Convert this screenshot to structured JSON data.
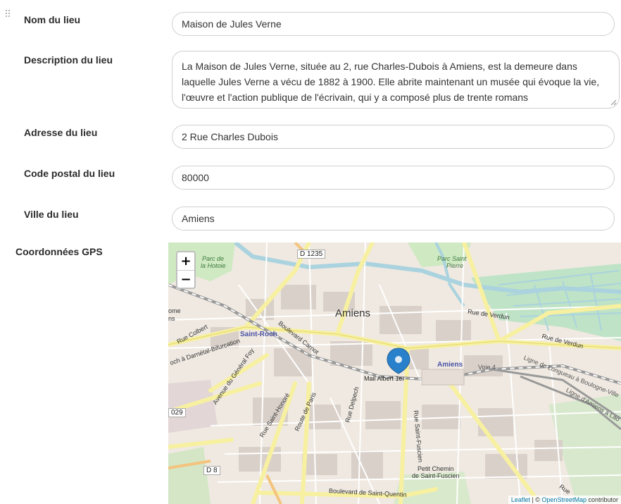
{
  "form": {
    "name_label": "Nom du lieu",
    "name_value": "Maison de Jules Verne",
    "description_label": "Description du lieu",
    "description_value": "La Maison de Jules Verne, située au 2, rue Charles-Dubois à Amiens, est la demeure dans laquelle Jules Verne a vécu de 1882 à 1900. Elle abrite maintenant un musée qui évoque la vie, l'œuvre et l'action publique de l'écrivain, qui y a composé plus de trente romans",
    "address_label": "Adresse du lieu",
    "address_value": "2 Rue Charles Dubois",
    "postcode_label": "Code postal du lieu",
    "postcode_value": "80000",
    "city_label": "Ville du lieu",
    "city_value": "Amiens",
    "gps_label": "Coordonnées GPS"
  },
  "map": {
    "zoom_in": "+",
    "zoom_out": "−",
    "attribution_leaflet": "Leaflet",
    "attribution_sep": " | © ",
    "attribution_osm": "OpenStreetMap",
    "attribution_rest": " contributor",
    "labels": {
      "city": "Amiens",
      "d1235": "D 1235",
      "parc_hotoie_1": "Parc de",
      "parc_hotoie_2": "la Hotoie",
      "parc_saint_pierre_1": "Parc Saint",
      "parc_saint_pierre_2": "Pierre",
      "rue_verdun_1": "Rue de Verdun",
      "rue_verdun_2": "Rue de Verdun",
      "saint_roch": "Saint-Roch",
      "rue_colbert": "Rue Colbert",
      "boulevard_carnot": "Boulevard Carnot",
      "avenue_general_foy": "Avenue du Général Foy",
      "mail_albert": "Mail Albert 1er",
      "amiens_station": "Amiens",
      "voie4": "Voie 4",
      "rue_saint_honore": "Rue Saint-Honoré",
      "route_de_paris": "Route de Paris",
      "rue_delpech": "Rue Delpech",
      "rue_saint_fuscien": "Rue Saint-Fuscien",
      "petit_chemin_1": "Petit Chemin",
      "petit_chemin_2": "de Saint-Fuscien",
      "boulevard_saint_quentin": "Boulevard de Saint-Quentin",
      "d8": "D 8",
      "d029": "029",
      "ligne_longueau_1": "Ligne de Longueau à Boulogne-Ville",
      "ligne_longueau_2": "Ligne d'Amiens à Lao",
      "rue_darnetal": "och à Darnétal-Bifurcation",
      "rome": "ome",
      "ns": "ns",
      "rue_bd": "Rue"
    },
    "marker_color": "#2a81cb"
  }
}
